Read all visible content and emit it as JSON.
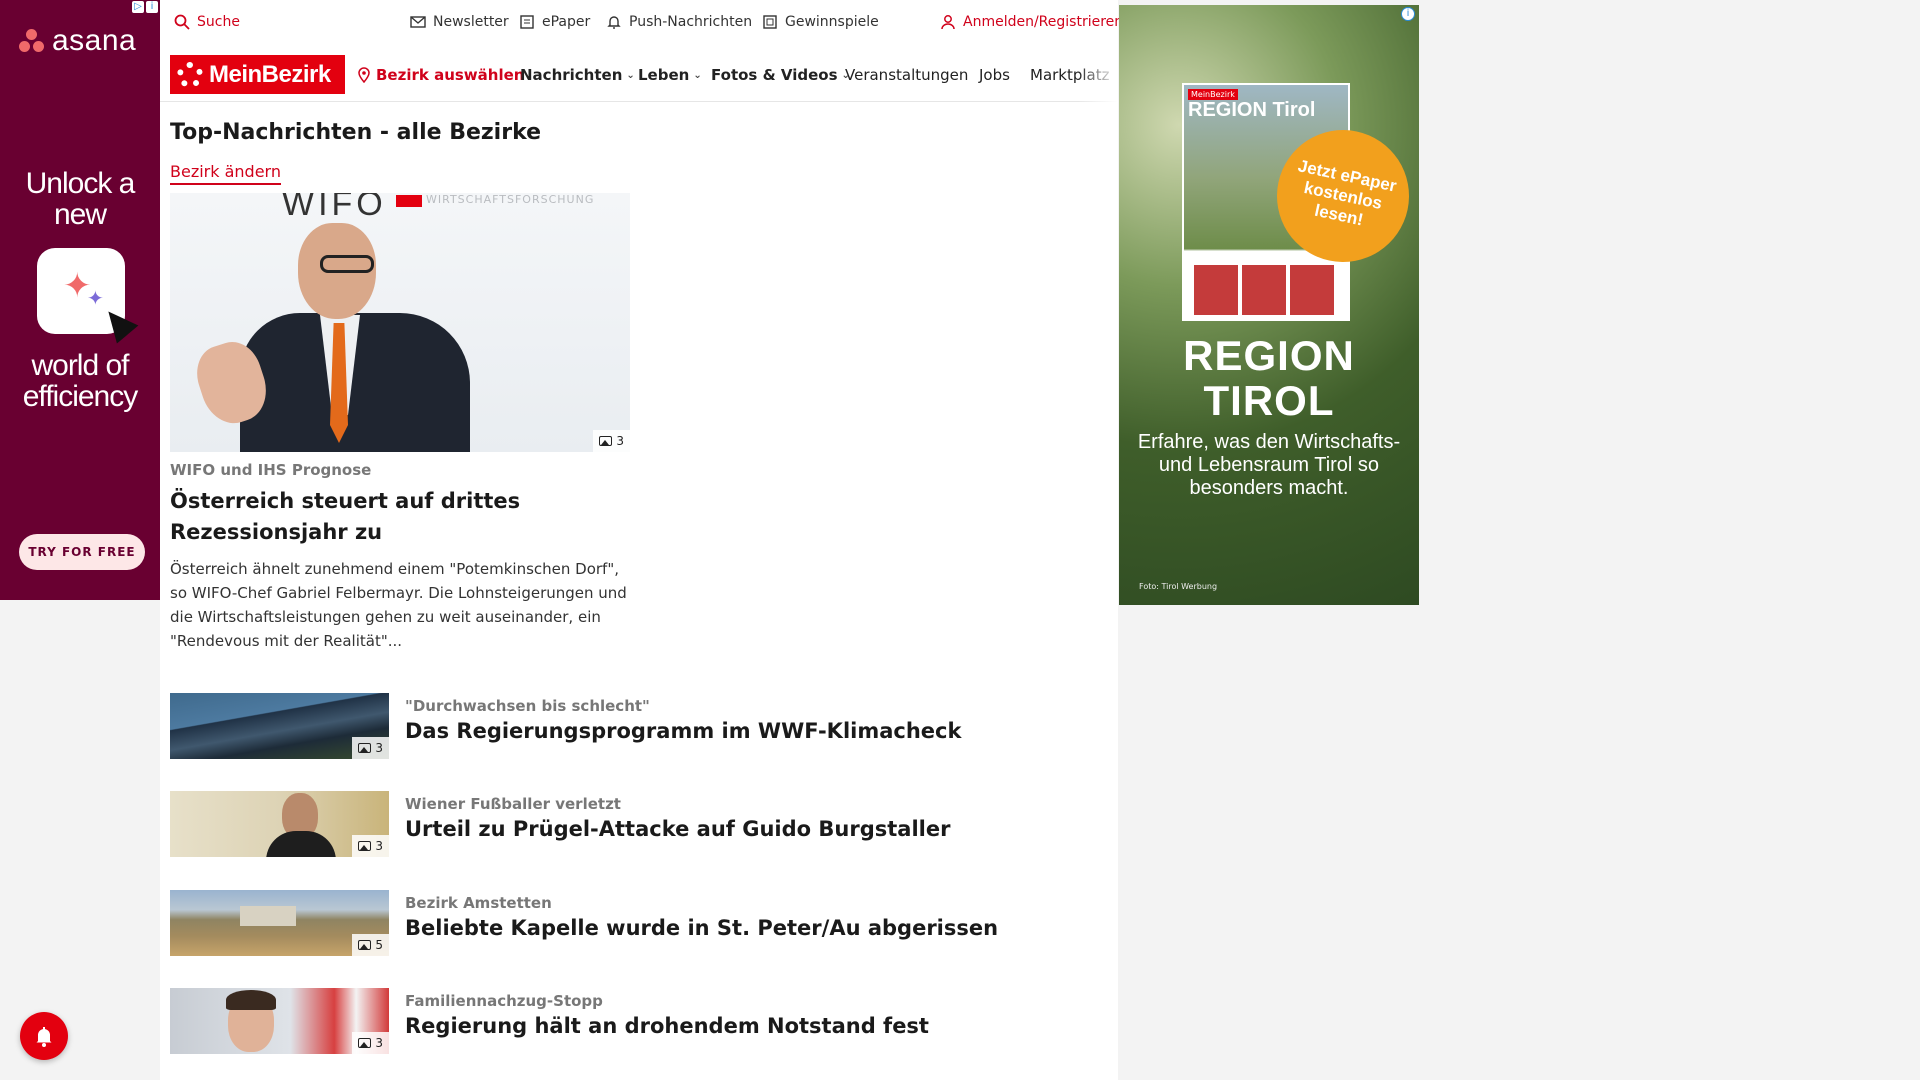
{
  "ad_left": {
    "brand": "asana",
    "headline_1": "Unlock a new",
    "headline_2": "world of efficiency",
    "cta": "TRY FOR FREE",
    "bg_color": "#690031",
    "accent_color": "#f06a6a"
  },
  "utility_bar": {
    "search": "Suche",
    "newsletter": "Newsletter",
    "epaper": "ePaper",
    "push": "Push-Nachrichten",
    "gewinnspiele": "Gewinnspiele",
    "login": "Anmelden/Registrieren"
  },
  "nav": {
    "logo": "MeinBezirk",
    "select_district": "Bezirk auswählen",
    "items": [
      {
        "label": "Nachrichten",
        "has_dropdown": true
      },
      {
        "label": "Leben",
        "has_dropdown": true
      },
      {
        "label": "Fotos & Videos",
        "has_dropdown": true
      },
      {
        "label": "Veranstaltungen",
        "has_dropdown": false
      },
      {
        "label": "Jobs",
        "has_dropdown": false
      },
      {
        "label": "Marktplatz",
        "has_dropdown": false
      }
    ]
  },
  "page": {
    "title": "Top-Nachrichten - alle Bezirke",
    "change_district": "Bezirk ändern"
  },
  "lead_article": {
    "image_text_wifo": "WIFO",
    "image_text_sub": "WIRTSCHAFTSFORSCHUNG",
    "image_count": "3",
    "kicker": "WIFO und IHS Prognose",
    "title": "Österreich steuert auf drittes Rezessionsjahr zu",
    "teaser": "Österreich ähnelt zunehmend einem \"Potemkinschen Dorf\", so WIFO-Chef Gabriel Felbermayr. Die Lohnsteigerungen und die Wirtschaftsleistungen gehen zu weit auseinander, ein \"Rendevous mit der Realität\"..."
  },
  "articles": [
    {
      "kicker": "\"Durchwachsen bis schlecht\"",
      "title": "Das Regierungsprogramm im WWF-Klimacheck",
      "image_count": "3"
    },
    {
      "kicker": "Wiener Fußballer verletzt",
      "title": "Urteil zu Prügel-Attacke auf Guido Burgstaller",
      "image_count": "3"
    },
    {
      "kicker": "Bezirk Amstetten",
      "title": "Beliebte Kapelle wurde in St. Peter/Au abgerissen",
      "image_count": "5"
    },
    {
      "kicker": "Familiennachzug-Stopp",
      "title": "Regierung hält an drohendem Notstand fest",
      "image_count": "3"
    }
  ],
  "ad_right": {
    "mag_brand": "MeinBezirk",
    "mag_title": "REGION Tirol",
    "badge": "Jetzt ePaper kostenlos lesen!",
    "headline": "REGION TIROL",
    "copy": "Erfahre, was den Wirtschafts- und Lebensraum Tirol so besonders macht.",
    "credit": "Foto: Tirol Werbung",
    "badge_color": "#f2a01d"
  },
  "colors": {
    "brand_red": "#e3000f",
    "link_red": "#d0021b"
  },
  "icons": [
    "search-icon",
    "mail-icon",
    "epaper-icon",
    "bell-icon",
    "gift-icon",
    "user-icon",
    "pin-icon",
    "chevron-down-icon",
    "gallery-icon",
    "notification-bell-icon"
  ]
}
